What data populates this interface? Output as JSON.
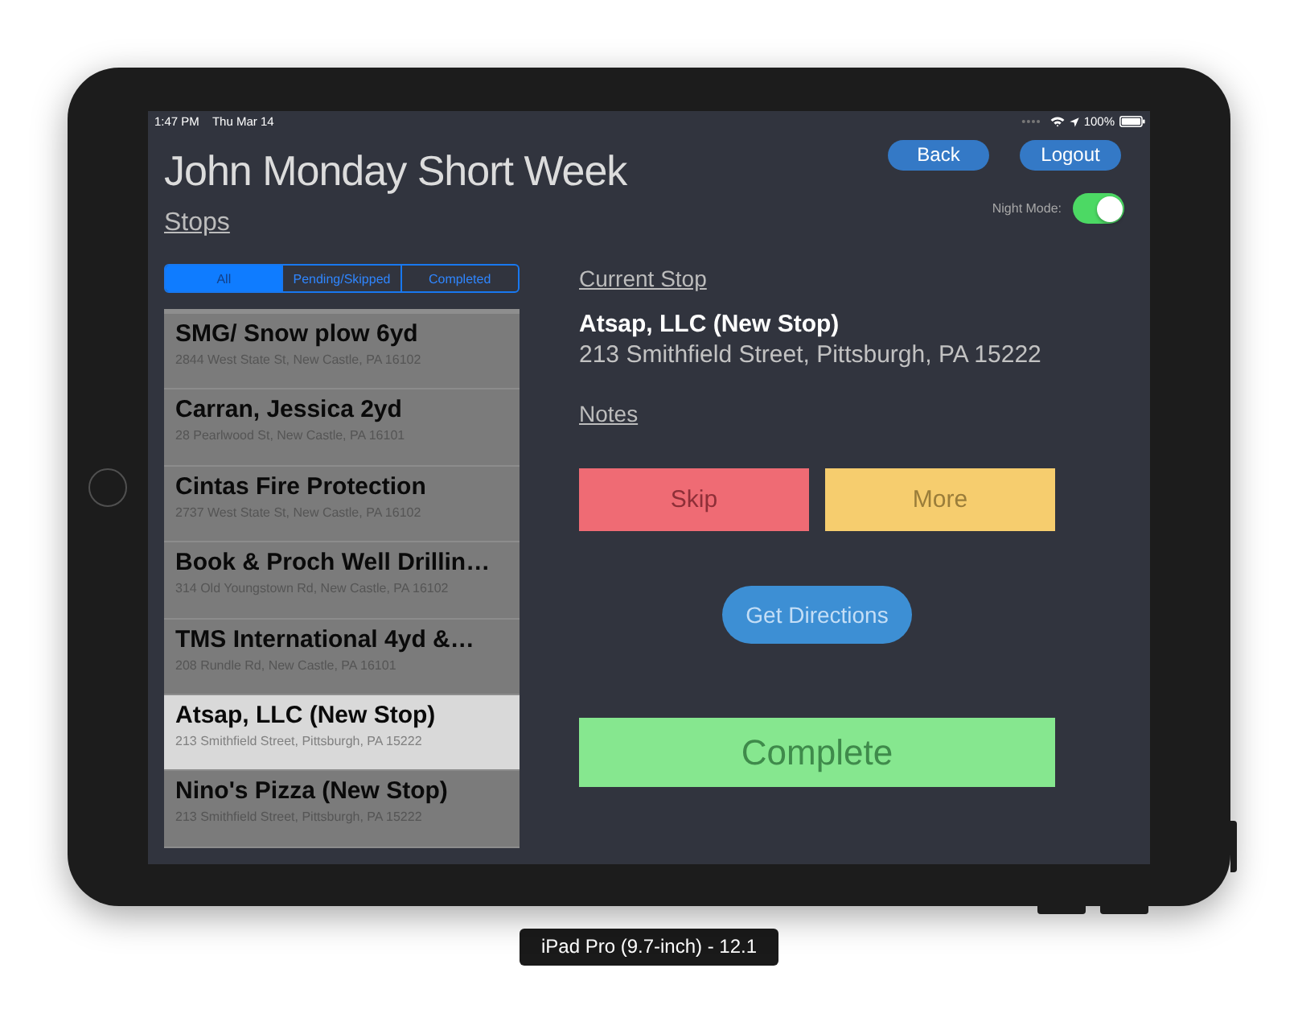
{
  "status_bar": {
    "time": "1:47 PM",
    "date": "Thu Mar 14",
    "battery_text": "100%"
  },
  "header": {
    "title": "John Monday Short Week",
    "section_link": "Stops",
    "buttons": [
      "Back",
      "Logout"
    ],
    "night_mode": {
      "label": "Night Mode:",
      "on": true
    }
  },
  "filter_tabs": [
    {
      "label": "All",
      "selected": true
    },
    {
      "label": "Pending/Skipped",
      "selected": false
    },
    {
      "label": "Completed",
      "selected": false
    }
  ],
  "stops": [
    {
      "name": "SMG/ Snow plow 6yd",
      "address": "2844 West State St, New Castle, PA 16102",
      "selected": false
    },
    {
      "name": "Carran, Jessica 2yd",
      "address": "28 Pearlwood St, New Castle, PA 16101",
      "selected": false
    },
    {
      "name": "Cintas Fire Protection",
      "address": "2737 West State St, New Castle, PA 16102",
      "selected": false
    },
    {
      "name": "Book & Proch Well Drillin…",
      "address": "314 Old Youngstown Rd, New Castle, PA 16102",
      "selected": false
    },
    {
      "name": "TMS International 4yd &…",
      "address": "208 Rundle Rd, New Castle, PA 16101",
      "selected": false
    },
    {
      "name": "Atsap, LLC (New Stop)",
      "address": "213 Smithfield Street, Pittsburgh, PA 15222",
      "selected": true
    },
    {
      "name": "Nino's Pizza (New Stop)",
      "address": "213 Smithfield Street, Pittsburgh, PA 15222",
      "selected": false
    }
  ],
  "current_stop": {
    "heading": "Current Stop",
    "name": "Atsap, LLC (New Stop)",
    "address": "213 Smithfield Street, Pittsburgh, PA 15222",
    "notes_label": "Notes"
  },
  "actions": [
    {
      "label": "Skip",
      "kind": "skip"
    },
    {
      "label": "More",
      "kind": "more"
    }
  ],
  "directions_button": "Get Directions",
  "complete_button": "Complete",
  "device_label": "iPad Pro (9.7-inch) - 12.1"
}
